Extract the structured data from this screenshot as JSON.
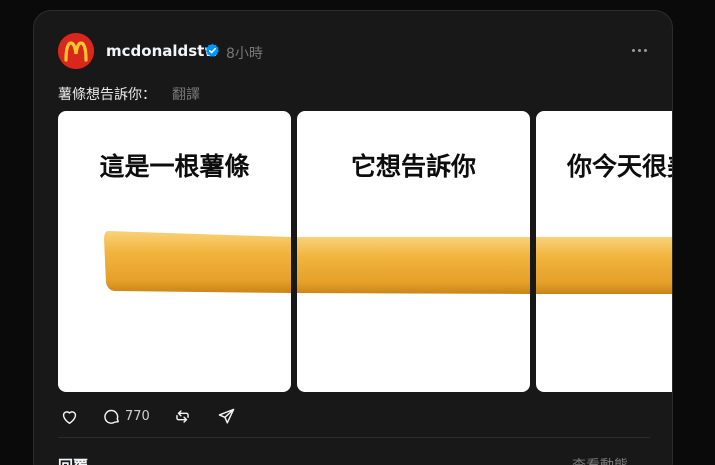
{
  "post": {
    "username": "mcdonaldstw",
    "timestamp": "8小時",
    "caption": "薯條想告訴你：",
    "translate_label": "翻譯",
    "slides": [
      {
        "title": "這是一根薯條"
      },
      {
        "title": "它想告訴你"
      },
      {
        "title": "你今天很美"
      }
    ],
    "comment_count": "770",
    "replies_label": "回覆",
    "view_activity_label": "查看動態"
  },
  "colors": {
    "brand_red": "#d9271e",
    "brand_yellow": "#ffc72c",
    "verified_blue": "#0095f6",
    "fry": "#f2b43c"
  }
}
